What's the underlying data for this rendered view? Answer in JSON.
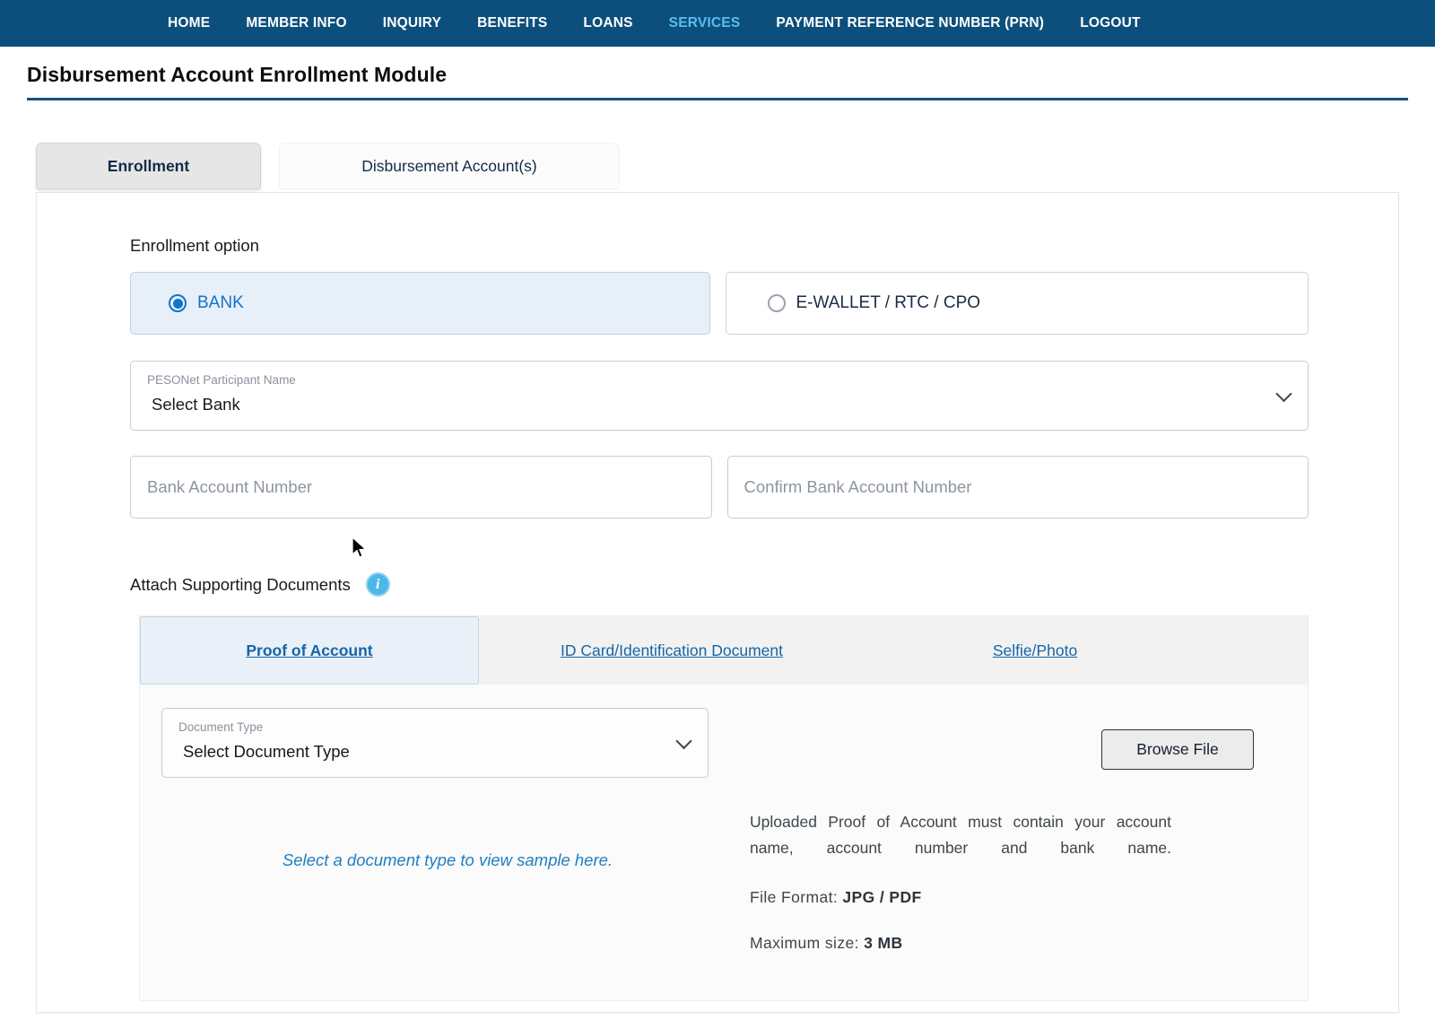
{
  "topnav": {
    "items": [
      {
        "label": "HOME",
        "active": false
      },
      {
        "label": "MEMBER INFO",
        "active": false
      },
      {
        "label": "INQUIRY",
        "active": false
      },
      {
        "label": "BENEFITS",
        "active": false
      },
      {
        "label": "LOANS",
        "active": false
      },
      {
        "label": "SERVICES",
        "active": true
      },
      {
        "label": "PAYMENT REFERENCE NUMBER (PRN)",
        "active": false
      },
      {
        "label": "LOGOUT",
        "active": false
      }
    ],
    "background_color": "#0d4f7c",
    "active_color": "#59bdf0"
  },
  "page": {
    "title": "Disbursement Account Enrollment Module",
    "rule_color": "#1c4f82"
  },
  "tabs": [
    {
      "label": "Enrollment",
      "active": true
    },
    {
      "label": "Disbursement Account(s)",
      "active": false
    }
  ],
  "enrollment": {
    "section_label": "Enrollment option",
    "options": [
      {
        "label": "BANK",
        "selected": true
      },
      {
        "label": "E-WALLET / RTC / CPO",
        "selected": false
      }
    ],
    "bank_select": {
      "caption": "PESONet Participant Name",
      "value": "Select Bank",
      "chevron": "chevron-down-icon"
    },
    "account_number": {
      "placeholder": "Bank Account Number",
      "value": ""
    },
    "confirm_account_number": {
      "placeholder": "Confirm Bank Account Number",
      "value": ""
    }
  },
  "attach": {
    "title": "Attach Supporting Documents",
    "info_icon": "info-icon",
    "info_glyph": "i",
    "doc_tabs": [
      {
        "label": "Proof of Account",
        "active": true
      },
      {
        "label": "ID Card/Identification Document",
        "active": false
      },
      {
        "label": "Selfie/Photo",
        "active": false
      }
    ],
    "document_type": {
      "caption": "Document Type",
      "value": "Select Document Type",
      "chevron": "chevron-down-icon"
    },
    "browse_button": "Browse File",
    "sample_hint": "Select a document type to view sample here.",
    "note": "Uploaded Proof of Account must contain your account name, account number and bank name.",
    "file_format_label": "File Format:",
    "file_format_value": "JPG / PDF",
    "max_size_label": "Maximum size:",
    "max_size_value": "3 MB"
  }
}
